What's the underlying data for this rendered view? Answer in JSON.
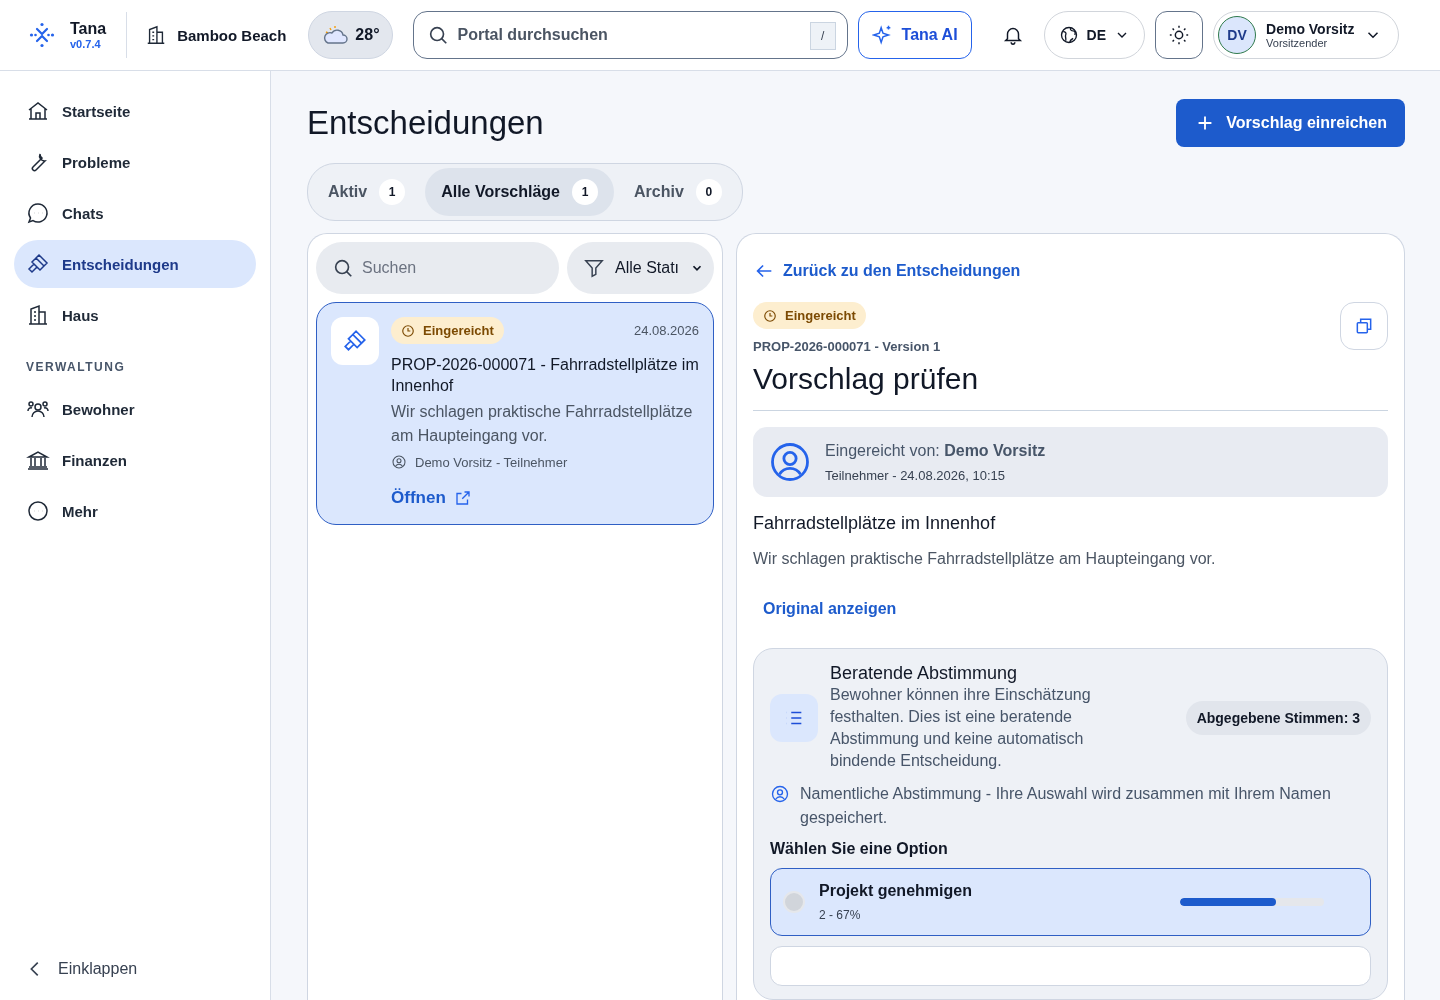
{
  "header": {
    "app_name": "Tana",
    "version": "v0.7.4",
    "property": "Bamboo Beach",
    "temperature": "28°",
    "search": {
      "placeholder": "Portal durchsuchen",
      "shortcut": "/"
    },
    "ai_button": "Tana AI",
    "language": "DE",
    "user": {
      "initials": "DV",
      "name": "Demo Vorsitz",
      "role": "Vorsitzender"
    }
  },
  "sidebar": {
    "items": [
      {
        "label": "Startseite",
        "selected": false
      },
      {
        "label": "Probleme",
        "selected": false
      },
      {
        "label": "Chats",
        "selected": false
      },
      {
        "label": "Entscheidungen",
        "selected": true
      },
      {
        "label": "Haus",
        "selected": false
      }
    ],
    "section": "VERWALTUNG",
    "admin_items": [
      {
        "label": "Bewohner",
        "selected": false
      },
      {
        "label": "Finanzen",
        "selected": false
      },
      {
        "label": "Mehr",
        "selected": false
      }
    ],
    "collapse": "Einklappen"
  },
  "page": {
    "title": "Entscheidungen",
    "primary_button": "Vorschlag einreichen",
    "tabs": [
      {
        "label": "Aktiv",
        "count": "1",
        "selected": false
      },
      {
        "label": "Alle Vorschläge",
        "count": "1",
        "selected": true
      },
      {
        "label": "Archiv",
        "count": "0",
        "selected": false
      }
    ]
  },
  "list": {
    "search": {
      "placeholder": "Suchen"
    },
    "filter": "Alle Statı",
    "items": [
      {
        "status": "Eingereicht",
        "date": "24.08.2026",
        "title": "PROP-2026-000071 - Fahrradstellplätze im Innenhof",
        "description": "Wir schlagen praktische Fahrradstellplätze am Haupteingang vor.",
        "author": "Demo Vorsitz - Teilnehmer",
        "action": "Öffnen",
        "selected": true
      }
    ]
  },
  "detail": {
    "back_link": "Zurück zu den Entscheidungen",
    "status": "Eingereicht",
    "reference": "PROP-2026-000071 - Version 1",
    "title": "Vorschlag prüfen",
    "submitter": {
      "text": "Eingereicht von: **Demo Vorsitz**",
      "meta": "Teilnehmer - 24.08.2026, 10:15"
    },
    "subject": "Fahrradstellplätze im Innenhof",
    "body": "Wir schlagen praktische Fahrradstellplätze am Haupteingang vor.",
    "original_link": "Original anzeigen",
    "vote": {
      "title": "Beratende Abstimmung",
      "description": "Bewohner können ihre Einschätzung festhalten. Dies ist eine beratende Abstimmung und keine automatisch bindende Entscheidung.",
      "count": "Abgegebene Stimmen: 3",
      "notice": "Namentliche Abstimmung - Ihre Auswahl wird zusammen mit Ihrem Namen gespeichert.",
      "prompt": "Wählen Sie eine Option",
      "options": [
        {
          "label": "Projekt genehmigen",
          "result": "2 - 67%",
          "level": 0.67,
          "leading": true
        }
      ]
    }
  }
}
